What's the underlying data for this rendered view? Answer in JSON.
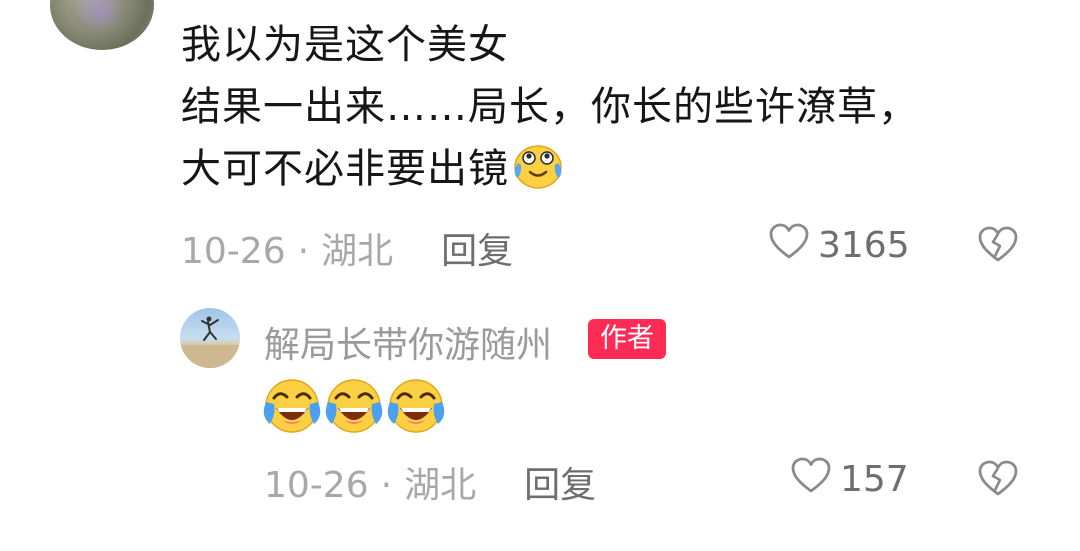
{
  "comment": {
    "text_line1": "我以为是这个美女",
    "text_line2": "结果一出来……局长，你长的些许潦草，",
    "text_line3": "大可不必非要出镜",
    "date": "10-26",
    "separator": "·",
    "location": "湖北",
    "reply_label": "回复",
    "like_count": "3165",
    "emoji_icon": "tearful-smile-emoji-icon"
  },
  "reply": {
    "author_name": "解局长带你游随州",
    "author_badge": "作者",
    "emojis": [
      "laugh-cry-emoji-icon",
      "laugh-cry-emoji-icon",
      "laugh-cry-emoji-icon"
    ],
    "date": "10-26",
    "separator": "·",
    "location": "湖北",
    "reply_label": "回复",
    "like_count": "157"
  },
  "colors": {
    "badge": "#fe2c55",
    "meta_text": "#a8a8a8",
    "body_text": "#161616"
  }
}
